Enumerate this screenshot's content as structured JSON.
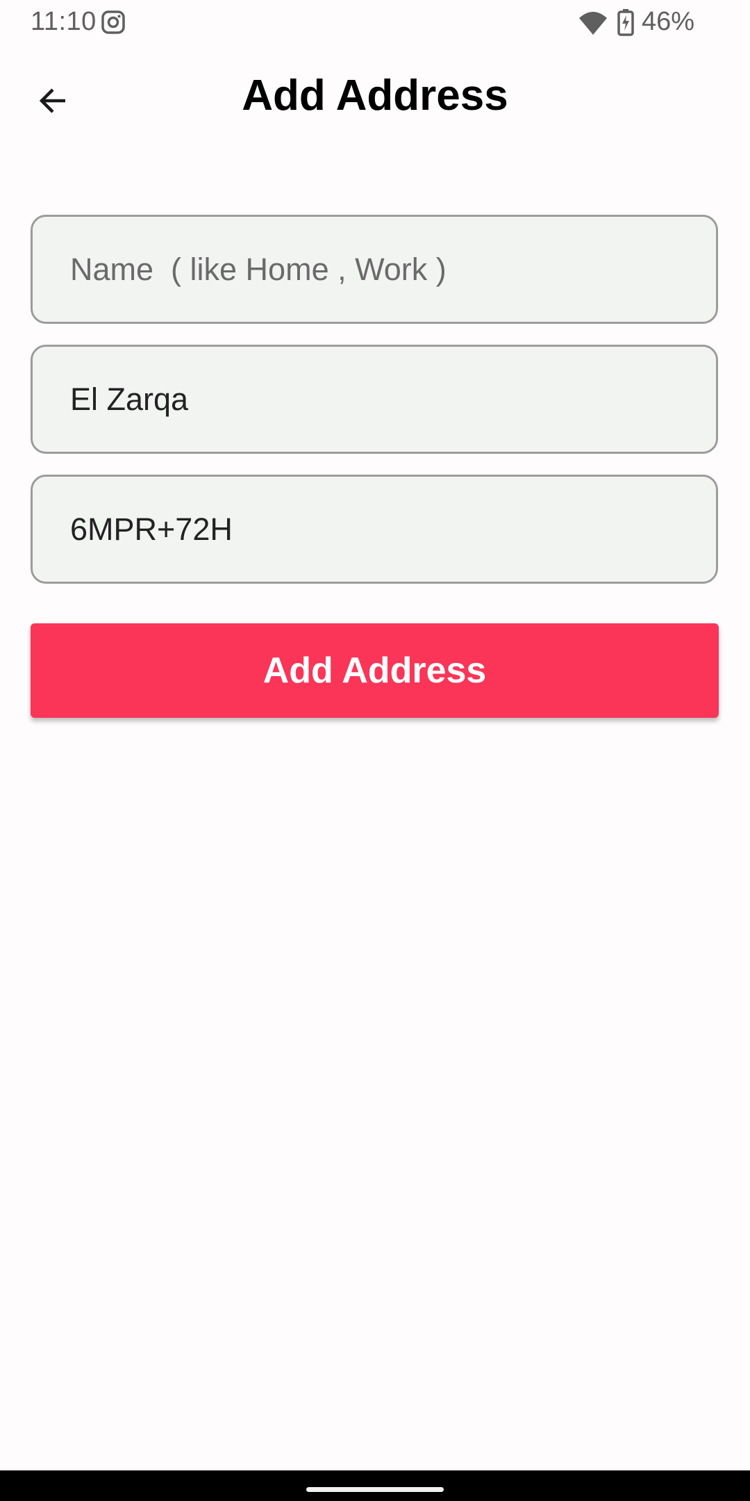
{
  "status_bar": {
    "time": "11:10",
    "battery": "46%",
    "icons": [
      "instagram-icon",
      "wifi-icon",
      "battery-charging-icon"
    ]
  },
  "header": {
    "title": "Add Address",
    "back_icon": "arrow-left-icon"
  },
  "form": {
    "name_field": {
      "placeholder": "Name  ( like Home , Work )",
      "value": ""
    },
    "city_field": {
      "placeholder": "",
      "value": "El Zarqa"
    },
    "code_field": {
      "placeholder": "",
      "value": "6MPR+72H"
    },
    "submit_label": "Add Address"
  },
  "colors": {
    "accent": "#fa3558",
    "field_background": "#f2f4f2",
    "field_border": "#9c9c9c",
    "page_background": "#fffcfd"
  }
}
